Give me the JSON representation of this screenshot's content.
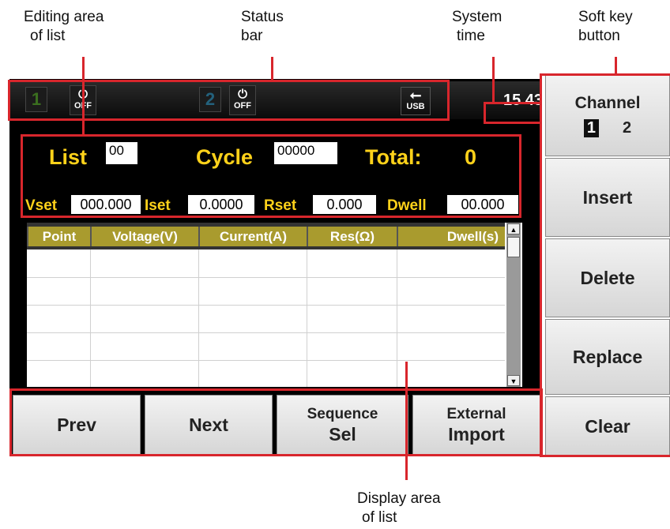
{
  "callouts": {
    "editing_area": [
      "Editing area",
      "of list"
    ],
    "status_bar": [
      "Status",
      "bar"
    ],
    "system_time": [
      "System",
      "time"
    ],
    "soft_key": [
      "Soft key",
      "button"
    ],
    "display_area": [
      "Display area",
      "of list"
    ]
  },
  "status": {
    "ch1": "1",
    "ch2": "2",
    "power1": "OFF",
    "power2": "OFF",
    "usb": "USB",
    "time": "15 43"
  },
  "edit": {
    "list_label": "List",
    "list_value": "00",
    "cycle_label": "Cycle",
    "cycle_value": "00000",
    "total_label": "Total:",
    "total_value": "0",
    "vset_label": "Vset",
    "vset_value": "000.000",
    "iset_label": "Iset",
    "iset_value": "0.0000",
    "rset_label": "Rset",
    "rset_value": "0.000",
    "dwell_label": "Dwell",
    "dwell_value": "00.000"
  },
  "table": {
    "columns": [
      "Point",
      "Voltage(V)",
      "Current(A)",
      "Res(Ω)",
      "Dwell(s)"
    ]
  },
  "bottom_keys": {
    "prev": "Prev",
    "next": "Next",
    "sequence_line1": "Sequence",
    "sequence_line2": "Sel",
    "external_line1": "External",
    "external_line2": "Import"
  },
  "soft_keys": {
    "channel": "Channel",
    "channel_1": "1",
    "channel_2": "2",
    "insert": "Insert",
    "delete": "Delete",
    "replace": "Replace",
    "clear": "Clear"
  },
  "colors": {
    "highlight": "#ffd21a",
    "annotation": "#d8262c",
    "header_cell": "#a99b2e"
  }
}
